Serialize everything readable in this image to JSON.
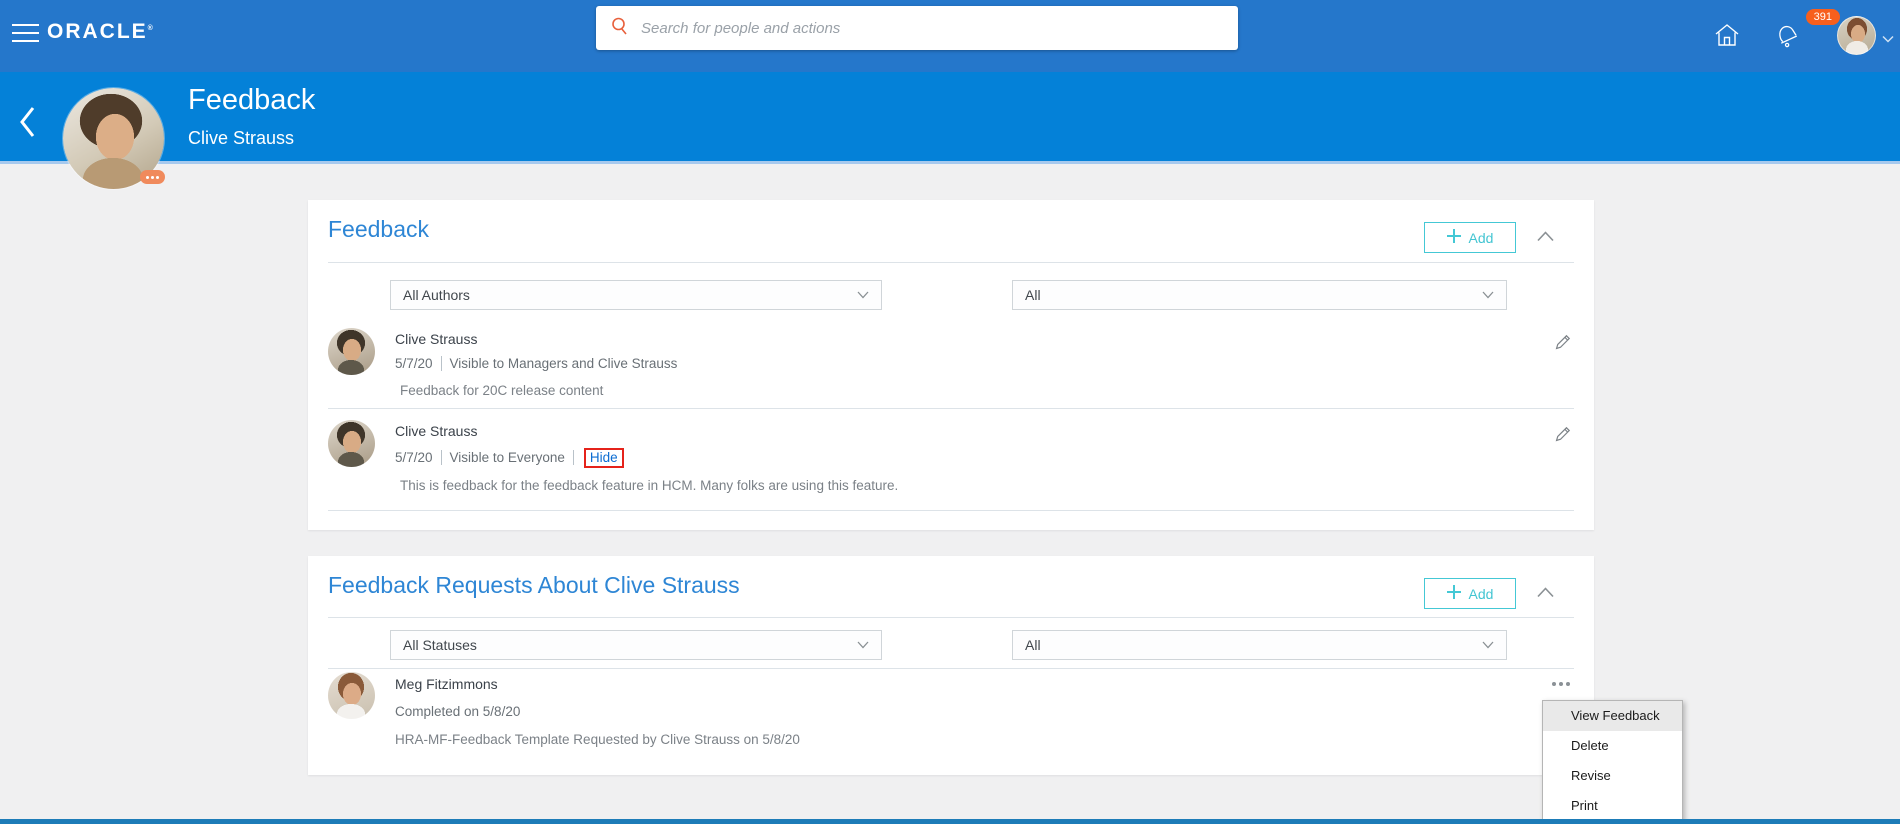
{
  "topbar": {
    "brand": "ORACLE",
    "brand_mark": "®",
    "search_placeholder": "Search for people and actions",
    "notification_count": "391"
  },
  "page_header": {
    "title": "Feedback",
    "subtitle": "Clive Strauss"
  },
  "feedback_card": {
    "title": "Feedback",
    "add_label": "Add",
    "author_filter_value": "All Authors",
    "type_filter_value": "All",
    "items": [
      {
        "name": "Clive Strauss",
        "date": "5/7/20",
        "visibility": "Visible to Managers and Clive Strauss",
        "body": "Feedback for 20C release content"
      },
      {
        "name": "Clive Strauss",
        "date": "5/7/20",
        "visibility": "Visible to Everyone",
        "hide_label": "Hide",
        "body": "This is feedback for the feedback feature in HCM. Many folks are using this feature."
      }
    ]
  },
  "requests_card": {
    "title": "Feedback Requests About Clive Strauss",
    "add_label": "Add",
    "status_filter_value": "All Statuses",
    "type_filter_value": "All",
    "items": [
      {
        "name": "Meg Fitzimmons",
        "status": "Completed on 5/8/20",
        "body": "HRA-MF-Feedback Template Requested by Clive Strauss on 5/8/20"
      }
    ]
  },
  "context_menu": {
    "items": [
      "View Feedback",
      "Delete",
      "Revise",
      "Print"
    ]
  },
  "colors": {
    "topbar_blue": "#2577cb",
    "header_blue": "#0481d8",
    "accent_teal": "#44c8d5",
    "title_blue": "#2e86d5",
    "link_blue": "#0c6cd2",
    "badge_orange": "#f75f1d",
    "annotation_red": "#e5231b",
    "bottom_bar_blue": "#1d7cb8"
  }
}
